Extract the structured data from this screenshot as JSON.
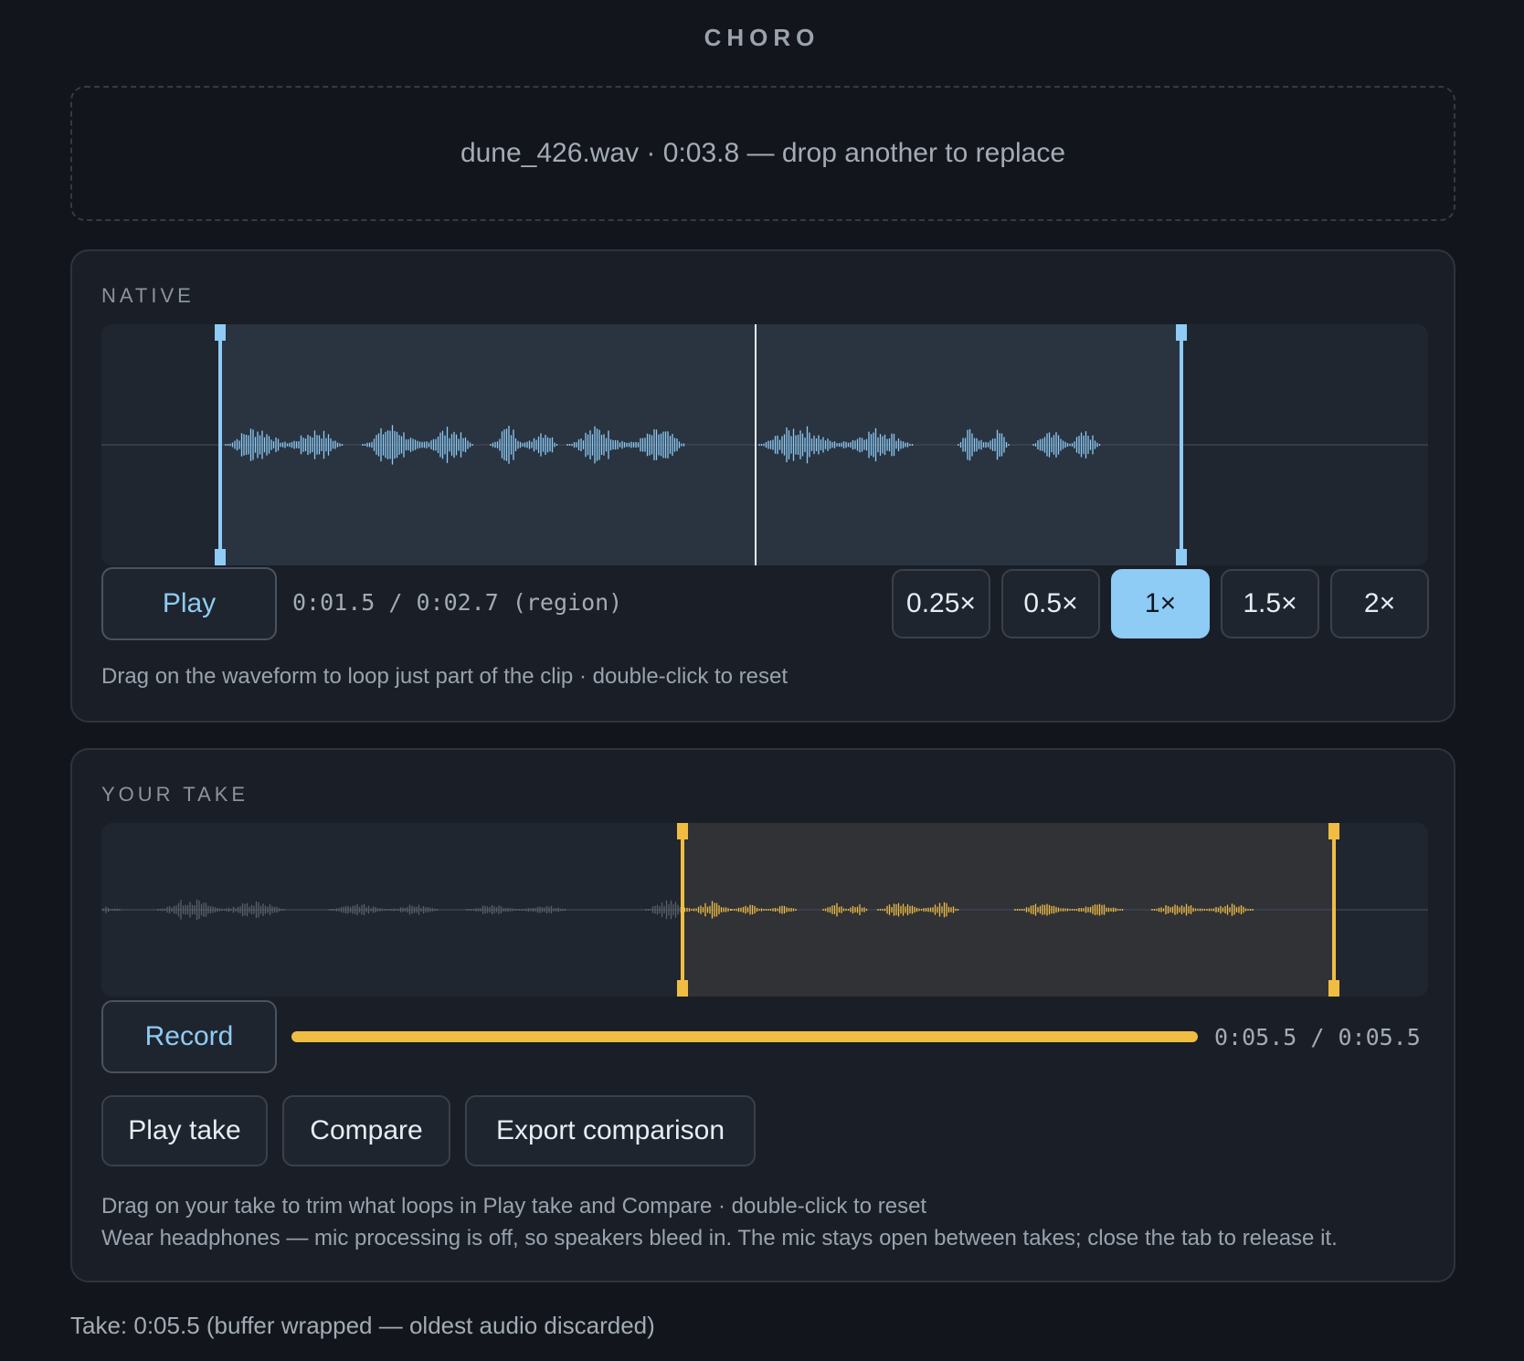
{
  "app": {
    "title": "CHORO"
  },
  "dropzone": {
    "text": "dune_426.wav · 0:03.8 — drop another to replace"
  },
  "native": {
    "label": "NATIVE",
    "play_label": "Play",
    "time_readout": "0:01.5 / 0:02.7 (region)",
    "speeds": [
      "0.25×",
      "0.5×",
      "1×",
      "1.5×",
      "2×"
    ],
    "active_speed": "1×",
    "hint": "Drag on the waveform to loop just part of the clip · double-click to reset",
    "colors": {
      "wave": "#8ecbf5",
      "region": "#2a3340"
    }
  },
  "take": {
    "label": "YOUR TAKE",
    "record_label": "Record",
    "time_readout": "0:05.5 / 0:05.5",
    "progress": 1.0,
    "buttons": {
      "play_take": "Play take",
      "compare": "Compare",
      "export": "Export comparison"
    },
    "hint_1": "Drag on your take to trim what loops in Play take and Compare · double-click to reset",
    "hint_2": "Wear headphones — mic processing is off, so speakers bleed in. The mic stays open between takes; close the tab to release it.",
    "colors": {
      "wave": "#f0bd43",
      "region": "#303236",
      "inactive_wave": "#5b6068"
    }
  },
  "status": {
    "text": "Take: 0:05.5 (buffer wrapped — oldest audio discarded)"
  }
}
